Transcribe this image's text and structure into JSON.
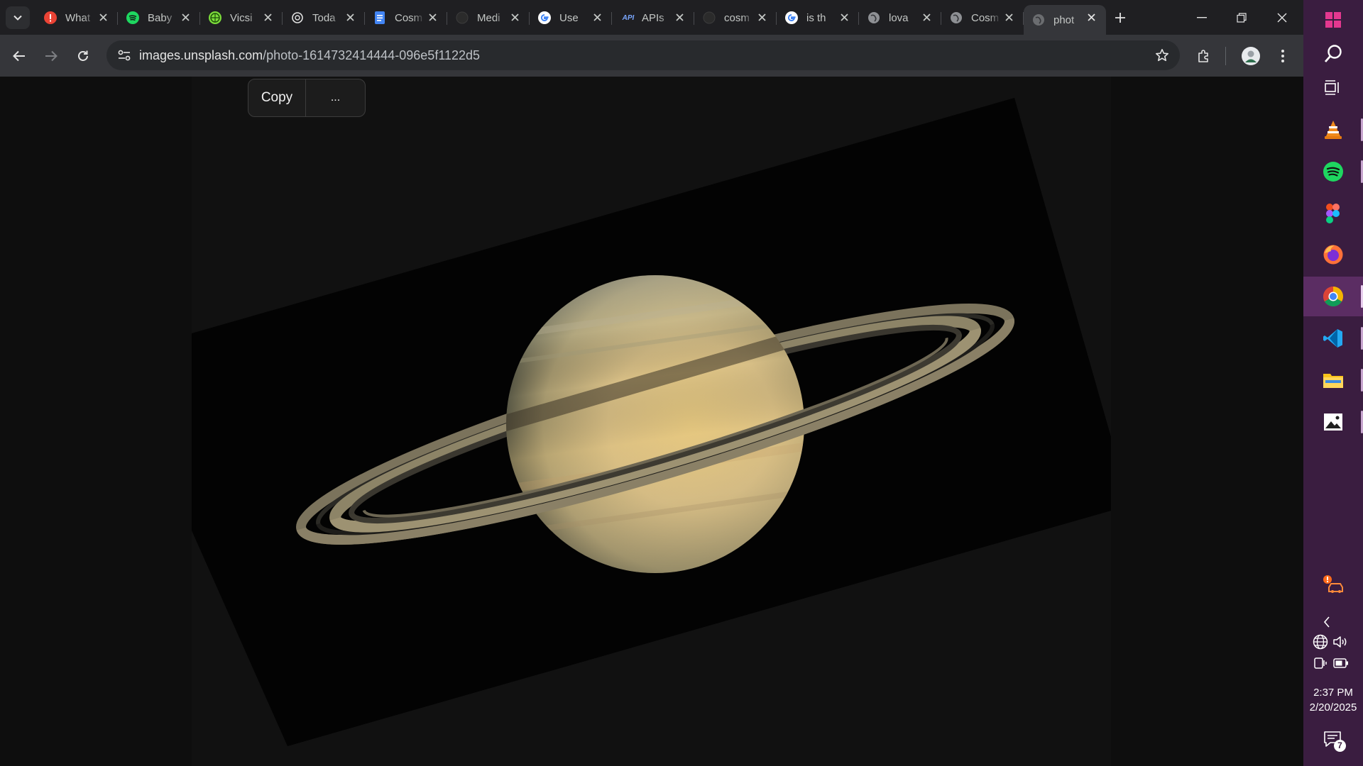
{
  "browser": {
    "tabs": [
      {
        "title": "What",
        "icon": "alert-red-icon",
        "active": false
      },
      {
        "title": "Baby",
        "icon": "spotify-icon",
        "active": false
      },
      {
        "title": "Vicsi",
        "icon": "globe-green-icon",
        "active": false
      },
      {
        "title": "Toda",
        "icon": "openai-icon",
        "active": false
      },
      {
        "title": "Cosm",
        "icon": "google-docs-icon",
        "active": false
      },
      {
        "title": "Medi",
        "icon": "github-icon",
        "active": false
      },
      {
        "title": "Use",
        "icon": "google-icon",
        "active": false
      },
      {
        "title": "APIs",
        "icon": "api-icon",
        "active": false
      },
      {
        "title": "cosm",
        "icon": "github-icon",
        "active": false
      },
      {
        "title": "is th",
        "icon": "google-icon",
        "active": false
      },
      {
        "title": "lova",
        "icon": "globe-icon",
        "active": false
      },
      {
        "title": "Cosm",
        "icon": "globe-icon",
        "active": false
      },
      {
        "title": "phot",
        "icon": "globe-icon",
        "active": true
      }
    ],
    "url": {
      "host": "images.unsplash.com",
      "path": "/photo-1614732414444-096e5f1122d5"
    },
    "popup": {
      "copy_label": "Copy",
      "more_label": "..."
    }
  },
  "taskbar": {
    "apps": [
      "windows-start-icon",
      "search-icon",
      "task-view-icon",
      "vlc-icon",
      "spotify-icon",
      "figma-icon",
      "firefox-icon",
      "chrome-icon",
      "vscode-icon",
      "file-explorer-icon",
      "photos-icon"
    ],
    "active_app": "chrome-icon",
    "time": "2:37 PM",
    "date": "2/20/2025",
    "notification_count": "7"
  },
  "colors": {
    "taskbar_bg": "#3a1d40",
    "tab_strip_bg": "#1f1f22",
    "toolbar_bg": "#35363a"
  }
}
